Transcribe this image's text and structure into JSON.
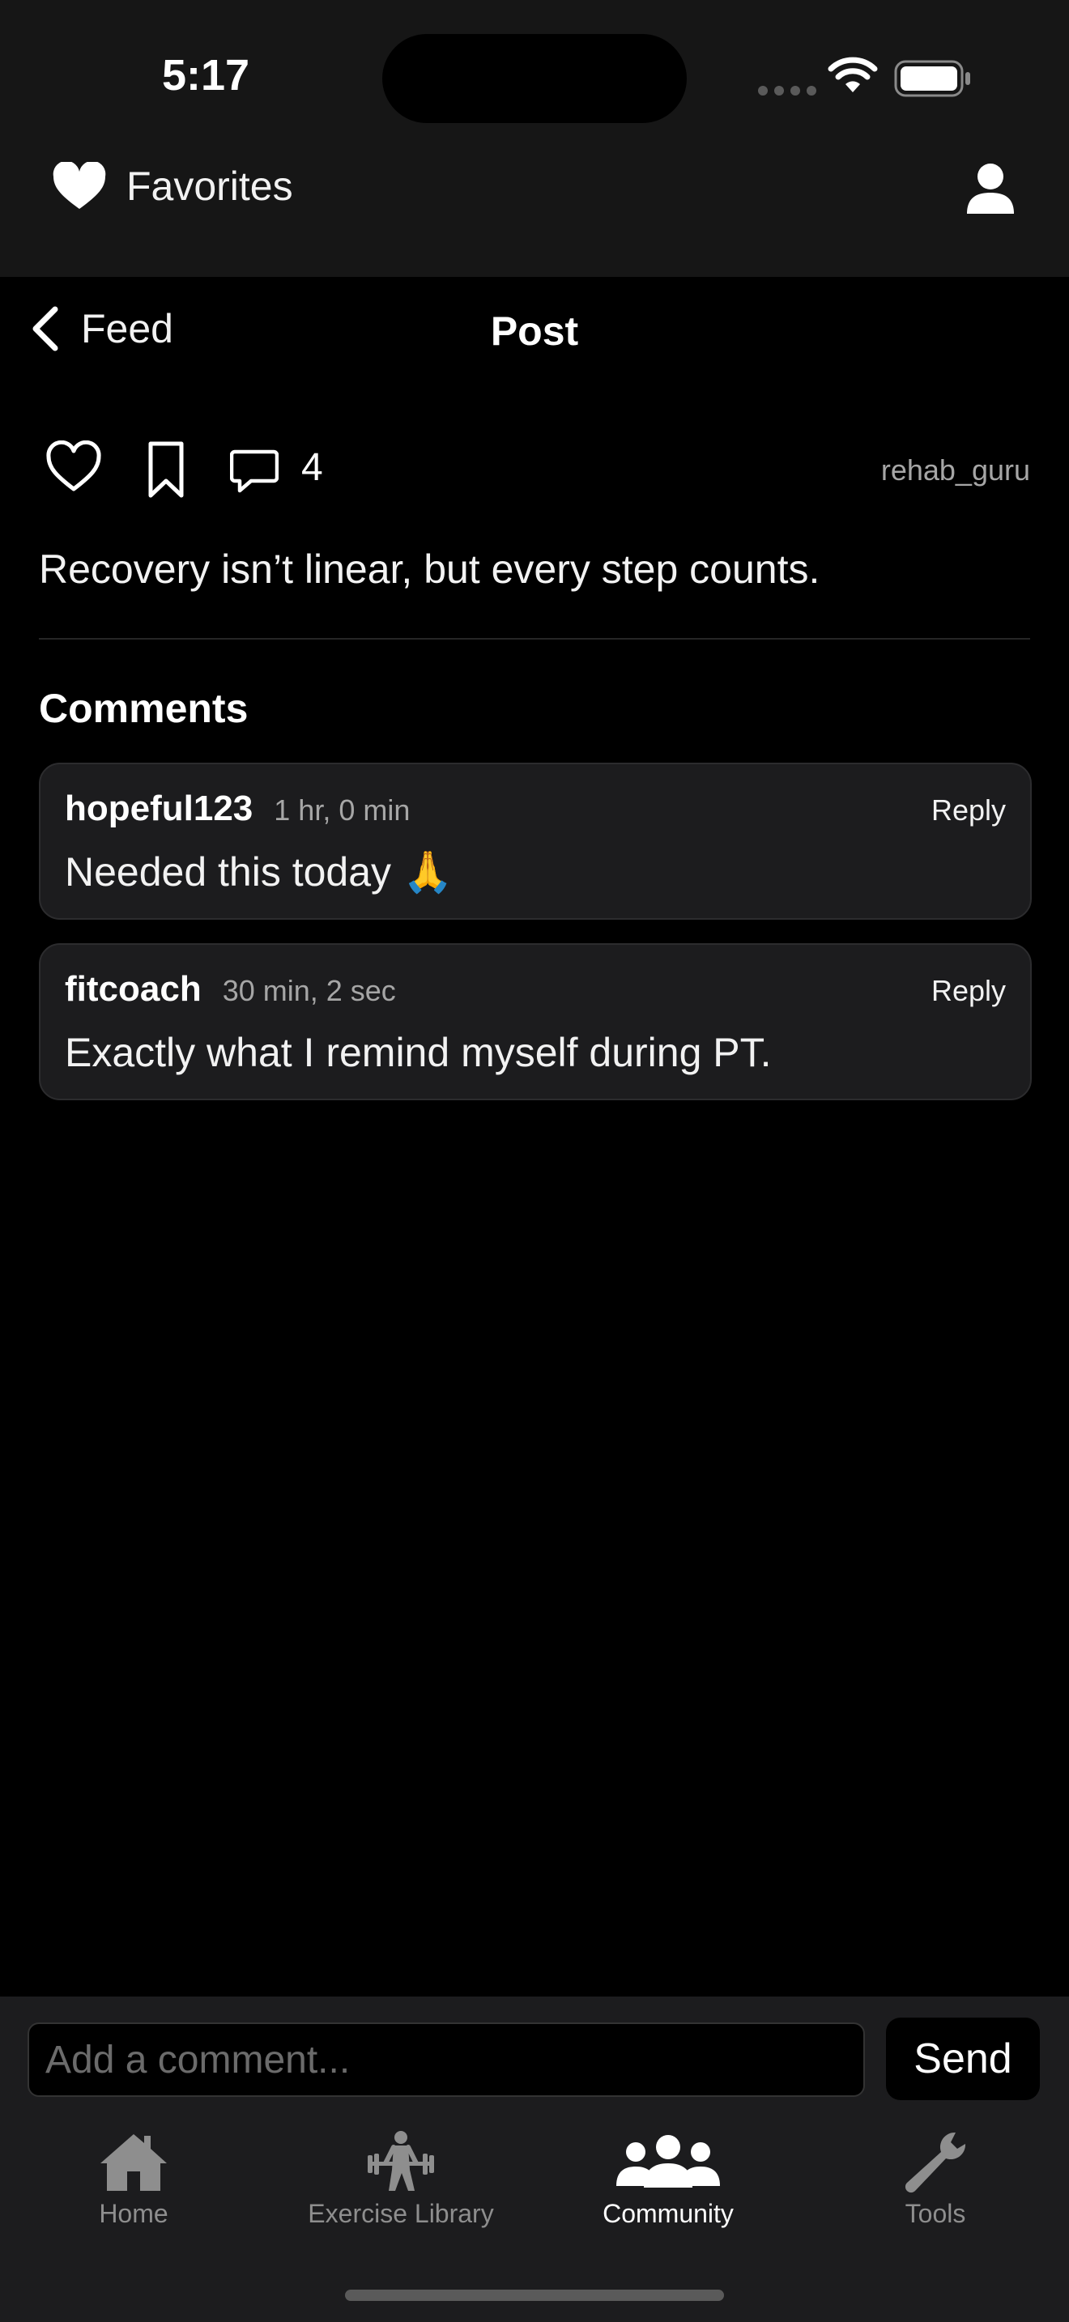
{
  "status_bar": {
    "time": "5:17"
  },
  "header": {
    "favorites_label": "Favorites",
    "profile_icon": "person-icon"
  },
  "nav": {
    "back_label": "Feed",
    "title": "Post"
  },
  "post": {
    "comment_count": "4",
    "author": "rehab_guru",
    "text": "Recovery isn’t linear, but every step counts."
  },
  "comments": {
    "title": "Comments",
    "items": [
      {
        "user": "hopeful123",
        "time": "1 hr, 0 min",
        "reply_label": "Reply",
        "text": "Needed this today 🙏"
      },
      {
        "user": "fitcoach",
        "time": "30 min, 2 sec",
        "reply_label": "Reply",
        "text": "Exactly what I remind myself during PT."
      }
    ]
  },
  "composer": {
    "placeholder": "Add a comment...",
    "send_label": "Send"
  },
  "tabs": [
    {
      "label": "Home",
      "icon": "house-icon",
      "active": false
    },
    {
      "label": "Exercise Library",
      "icon": "weightlifter-icon",
      "active": false
    },
    {
      "label": "Community",
      "icon": "people-icon",
      "active": true
    },
    {
      "label": "Tools",
      "icon": "wrench-icon",
      "active": false
    }
  ]
}
